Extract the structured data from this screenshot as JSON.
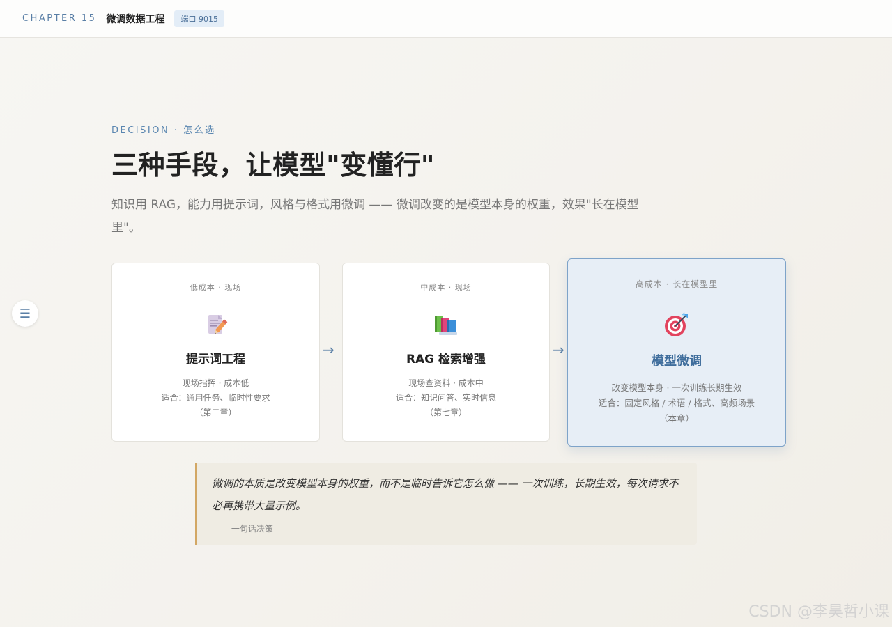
{
  "header": {
    "chapter": "CHAPTER 15",
    "title": "微调数据工程",
    "port_badge": "端口 9015"
  },
  "menu": {
    "icon": "menu-icon",
    "glyph": "☰"
  },
  "main": {
    "eyebrow": "DECISION · 怎么选",
    "title": "三种手段，让模型\"变懂行\"",
    "subtitle": "知识用 RAG，能力用提示词，风格与格式用微调 —— 微调改变的是模型本身的权重，效果\"长在模型里\"。"
  },
  "cards": [
    {
      "tag": "低成本 · 现场",
      "icon": "memo-pencil-icon",
      "name": "提示词工程",
      "desc1": "现场指挥 · 成本低",
      "desc2": "适合：通用任务、临时性要求",
      "desc3": "（第二章）"
    },
    {
      "tag": "中成本 · 现场",
      "icon": "books-icon",
      "name": "RAG 检索增强",
      "desc1": "现场查资料 · 成本中",
      "desc2": "适合：知识问答、实时信息",
      "desc3": "（第七章）"
    },
    {
      "tag": "高成本 · 长在模型里",
      "icon": "target-dart-icon",
      "name": "模型微调",
      "desc1": "改变模型本身 · 一次训练长期生效",
      "desc2": "适合：固定风格 / 术语 / 格式、高频场景",
      "desc3": "（本章）"
    }
  ],
  "arrows": [
    "→",
    "→"
  ],
  "quote": {
    "text": "微调的本质是改变模型本身的权重，而不是临时告诉它怎么做 —— 一次训练，长期生效，每次请求不必再携带大量示例。",
    "source": "—— 一句话决策"
  },
  "watermark": "CSDN @李昊哲小课",
  "colors": {
    "accent": "#5a7fa6",
    "highlight_card_bg": "#e7eef6",
    "highlight_card_border": "#7ea3c9",
    "quote_border": "#d2a764"
  }
}
